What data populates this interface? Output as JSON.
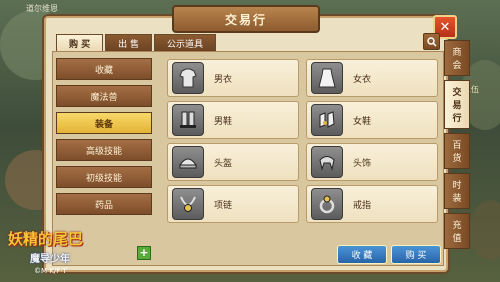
{
  "window": {
    "title": "交易行",
    "close_label": "✕"
  },
  "background": {
    "chat_line": "道尔维恩",
    "right_text": "人伍"
  },
  "tabs": [
    {
      "label": "购 买",
      "active": true
    },
    {
      "label": "出 售",
      "active": false
    },
    {
      "label": "公示道具",
      "active": false
    }
  ],
  "categories": [
    {
      "label": "收藏",
      "active": false
    },
    {
      "label": "魔法兽",
      "active": false
    },
    {
      "label": "装备",
      "active": true
    },
    {
      "label": "高级技能",
      "active": false
    },
    {
      "label": "初级技能",
      "active": false
    },
    {
      "label": "药品",
      "active": false
    }
  ],
  "items": [
    {
      "label": "男衣",
      "icon": "male-clothes-icon"
    },
    {
      "label": "女衣",
      "icon": "female-clothes-icon"
    },
    {
      "label": "男鞋",
      "icon": "male-shoes-icon"
    },
    {
      "label": "女鞋",
      "icon": "female-shoes-icon"
    },
    {
      "label": "头盔",
      "icon": "helmet-icon"
    },
    {
      "label": "头饰",
      "icon": "headwear-icon"
    },
    {
      "label": "项链",
      "icon": "necklace-icon"
    },
    {
      "label": "戒指",
      "icon": "ring-icon"
    }
  ],
  "buttons": {
    "favorite": "收 藏",
    "buy": "购 买"
  },
  "side_tabs": [
    {
      "label": "商会",
      "chars": [
        "商",
        "会"
      ],
      "active": false
    },
    {
      "label": "交易行",
      "chars": [
        "交",
        "易",
        "行"
      ],
      "active": true
    },
    {
      "label": "百货",
      "chars": [
        "百",
        "货"
      ],
      "active": false
    },
    {
      "label": "时装",
      "chars": [
        "时",
        "装"
      ],
      "active": false
    },
    {
      "label": "充值",
      "chars": [
        "充",
        "值"
      ],
      "active": false
    }
  ],
  "logo": {
    "line1": "妖精的尾巴",
    "line2": "魔导少年",
    "line3": "©M·K/F·T"
  }
}
